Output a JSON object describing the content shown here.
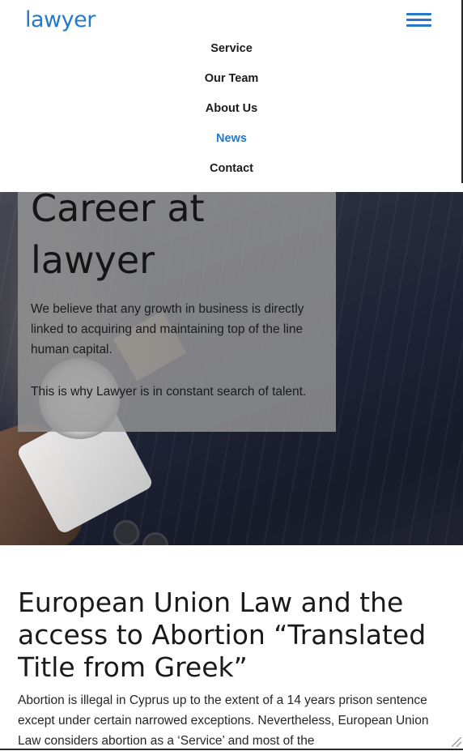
{
  "header": {
    "logo": "lawyer",
    "menu_icon": "hamburger-menu-icon"
  },
  "nav": {
    "items": [
      {
        "label": "Service",
        "active": false
      },
      {
        "label": "Our Team",
        "active": false
      },
      {
        "label": "About Us",
        "active": false
      },
      {
        "label": "News",
        "active": true
      },
      {
        "label": "Contact",
        "active": false
      }
    ]
  },
  "hero": {
    "title": "Career at lawyer",
    "paragraph1": "We believe that any growth in business is directly linked to acquiring and maintaining top of the line human capital.",
    "paragraph2": "This is why Lawyer is in constant search of talent."
  },
  "article": {
    "title": "European Union Law and the access to Abortion “Translated Title from Greek”",
    "body": "Abortion is illegal in Cyprus up to the extent of a 14 years prison sentence except under certain narrowed exceptions. Nevertheless, European Union Law considers abortion as a ‘Service’ and most of the"
  },
  "colors": {
    "accent": "#2678c9",
    "text": "#1a1a1a",
    "panel": "#969696"
  }
}
